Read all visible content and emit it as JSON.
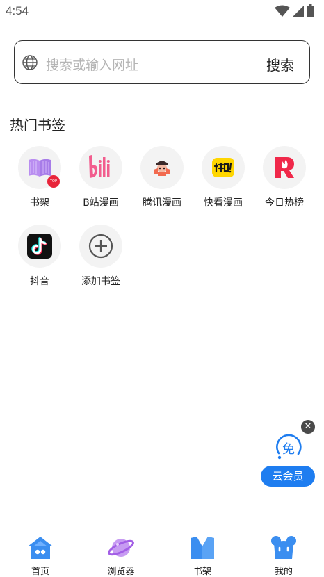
{
  "status_bar": {
    "time": "4:54"
  },
  "search": {
    "placeholder": "搜索或输入网址",
    "button_label": "搜索"
  },
  "section": {
    "title": "热门书签"
  },
  "bookmarks": [
    {
      "label": "书架",
      "badge": "TOP"
    },
    {
      "label": "B站漫画"
    },
    {
      "label": "腾讯漫画"
    },
    {
      "label": "快看漫画"
    },
    {
      "label": "今日热榜"
    },
    {
      "label": "抖音"
    },
    {
      "label": "添加书签"
    }
  ],
  "floating": {
    "close": "✕",
    "vip_label": "云会员",
    "vip_icon_text": "免"
  },
  "nav": [
    {
      "label": "首页"
    },
    {
      "label": "浏览器"
    },
    {
      "label": "书架"
    },
    {
      "label": "我的"
    }
  ],
  "colors": {
    "accent": "#1e7df0",
    "bili_pink": "#f25d8e",
    "kuaikan_yellow": "#ffd600",
    "toutiao_red": "#f0284a"
  }
}
